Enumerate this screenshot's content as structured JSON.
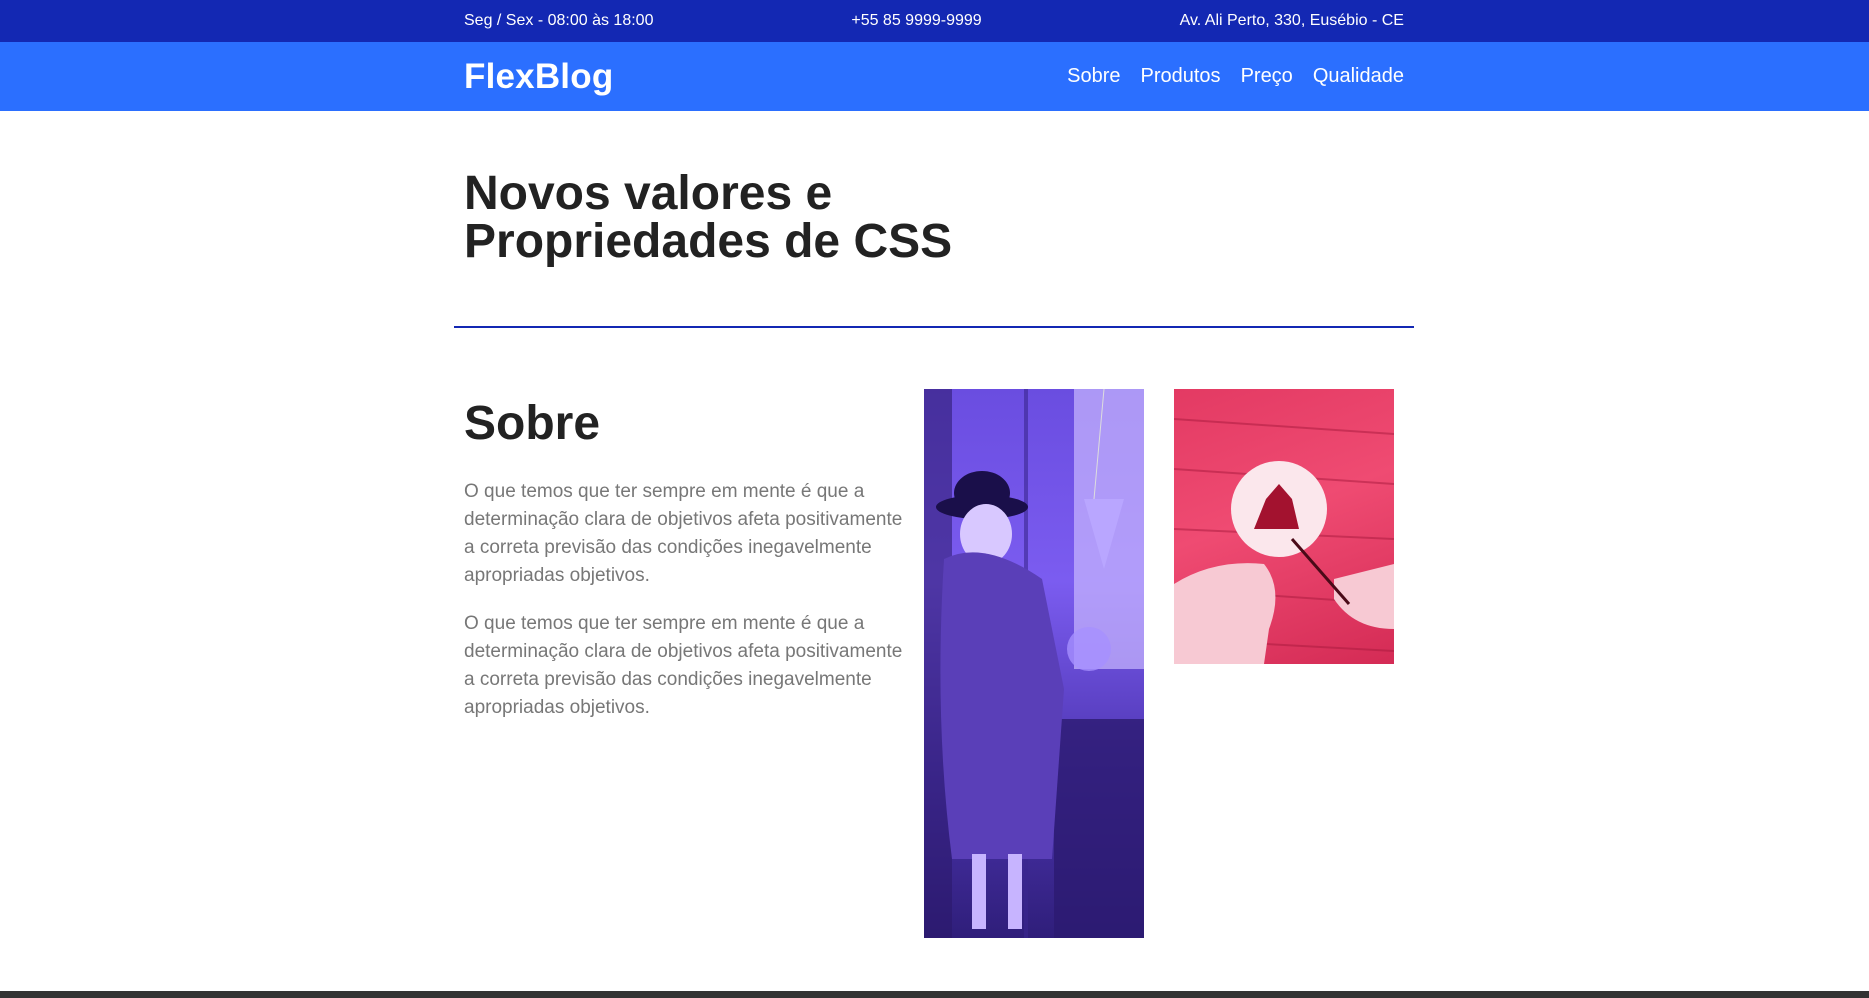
{
  "topbar": {
    "hours": "Seg / Sex - 08:00 às 18:00",
    "phone": "+55 85 9999-9999",
    "address": "Av. Ali Perto, 330, Eusébio - CE"
  },
  "header": {
    "logo": "FlexBlog",
    "nav": [
      "Sobre",
      "Produtos",
      "Preço",
      "Qualidade"
    ]
  },
  "main": {
    "title_line1": "Novos valores e",
    "title_line2": "Propriedades de CSS",
    "section_title": "Sobre",
    "paragraphs": [
      "O que temos que ter sempre em mente é que a determinação clara de objetivos afeta positivamente a correta previsão das condições inegavelmente apropriadas objetivos.",
      "O que temos que ter sempre em mente é que a determinação clara de objetivos afeta positivamente a correta previsão das condições inegavelmente apropriadas objetivos."
    ]
  },
  "colors": {
    "topbar": "#1328b3",
    "navbar": "#2b6fff",
    "divider": "#1328b3"
  }
}
